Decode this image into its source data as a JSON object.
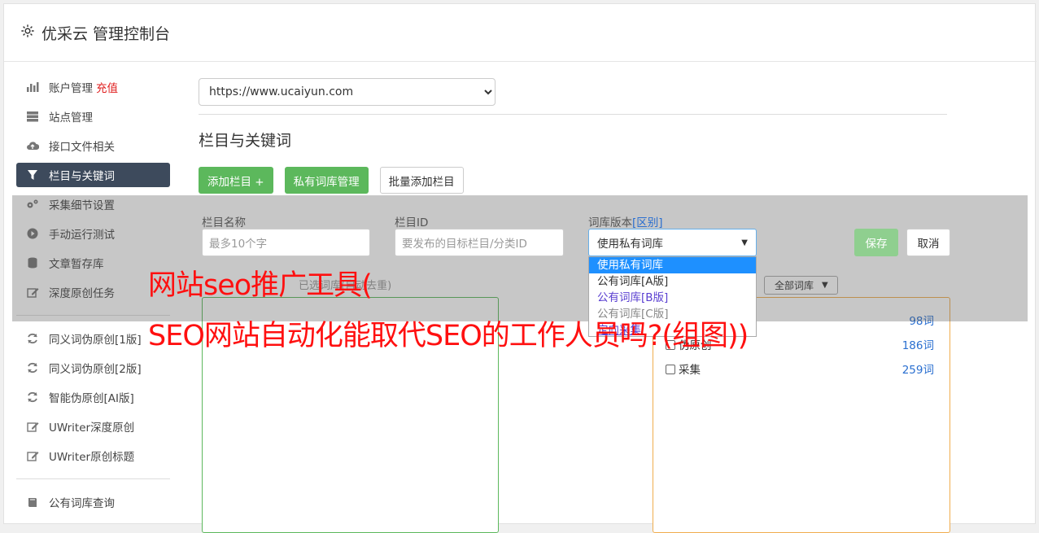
{
  "app": {
    "title": "优采云 管理控制台"
  },
  "sidebar": {
    "items": [
      {
        "label": "账户管理",
        "badge": "充值",
        "icon": "bar-chart-icon"
      },
      {
        "label": "站点管理",
        "icon": "server-icon"
      },
      {
        "label": "接口文件相关",
        "icon": "cloud-upload-icon"
      },
      {
        "label": "栏目与关键词",
        "icon": "filter-icon",
        "active": true
      },
      {
        "label": "采集细节设置",
        "icon": "gears-icon"
      },
      {
        "label": "手动运行测试",
        "icon": "play-icon"
      },
      {
        "label": "文章暂存库",
        "icon": "database-icon"
      },
      {
        "label": "深度原创任务",
        "icon": "edit-icon"
      }
    ],
    "items2": [
      {
        "label": "同义词伪原创[1版]",
        "icon": "refresh-icon"
      },
      {
        "label": "同义词伪原创[2版]",
        "icon": "refresh-icon"
      },
      {
        "label": "智能伪原创[AI版]",
        "icon": "refresh-icon"
      },
      {
        "label": "UWriter深度原创",
        "icon": "edit-icon"
      },
      {
        "label": "UWriter原创标题",
        "icon": "edit-icon"
      }
    ],
    "items3": [
      {
        "label": "公有词库查询",
        "icon": "book-icon"
      }
    ]
  },
  "main": {
    "site_url": "https://www.ucaiyun.com",
    "section_title": "栏目与关键词",
    "buttons": {
      "add_column": "添加栏目 +",
      "private_lib": "私有词库管理",
      "batch_add": "批量添加栏目"
    },
    "form": {
      "col_name_label": "栏目名称",
      "col_name_placeholder": "最多10个字",
      "col_id_label": "栏目ID",
      "col_id_placeholder": "要发布的目标栏目/分类ID",
      "lib_version_label": "词库版本",
      "lib_version_link": "[区别]",
      "lib_version_value": "使用私有词库",
      "save": "保存",
      "cancel": "取消"
    },
    "dropdown_options": [
      "使用私有词库",
      "公有词库[A版]",
      "公有词库[B版]",
      "公有词库[C版]",
      "定向采集"
    ],
    "selected_lib_label": "已选词库(自动去重)",
    "all_libs": "全部词库",
    "lib_rows": [
      {
        "name": "",
        "count": "98词"
      },
      {
        "name": "伪原创",
        "count": "186词"
      },
      {
        "name": "采集",
        "count": "259词"
      }
    ]
  },
  "headline": {
    "line1": "网站seo推广工具(",
    "line2": "SEO网站自动化能取代SEO的工作人员吗?(组图))"
  },
  "colors": {
    "accent_green": "#5cb85c",
    "active_nav": "#3d4a5c",
    "headline_red": "#ff1010"
  }
}
